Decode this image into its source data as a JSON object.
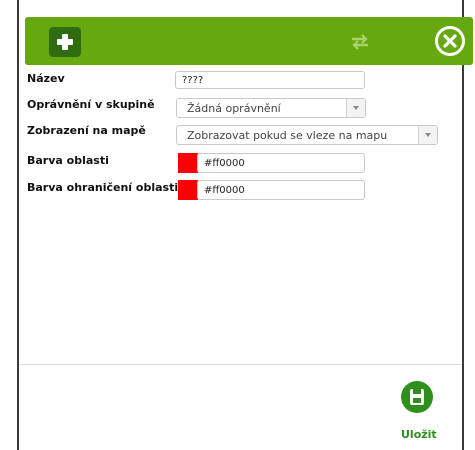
{
  "form": {
    "name_label": "Název",
    "name_value": "????",
    "permissions_label": "Oprávnění v skupině",
    "permissions_value": "Žádná oprávnění",
    "map_display_label": "Zobrazení na mapě",
    "map_display_value": "Zobrazovat pokud se vleze na mapu",
    "area_color_label": "Barva oblasti",
    "area_color_value": "#ff0000",
    "border_color_label": "Barva ohraničení oblasti",
    "border_color_value": "#ff0000"
  },
  "footer": {
    "save_label": "Uložit"
  },
  "colors": {
    "topbar": "#66a80f",
    "accent_dark": "#2f6d10",
    "save": "#2f8f1e",
    "swatch": "#ff0000"
  },
  "icons": {
    "add": "plus-icon",
    "sync": "sync-icon",
    "close": "close-icon",
    "save": "floppy-disk-icon"
  }
}
